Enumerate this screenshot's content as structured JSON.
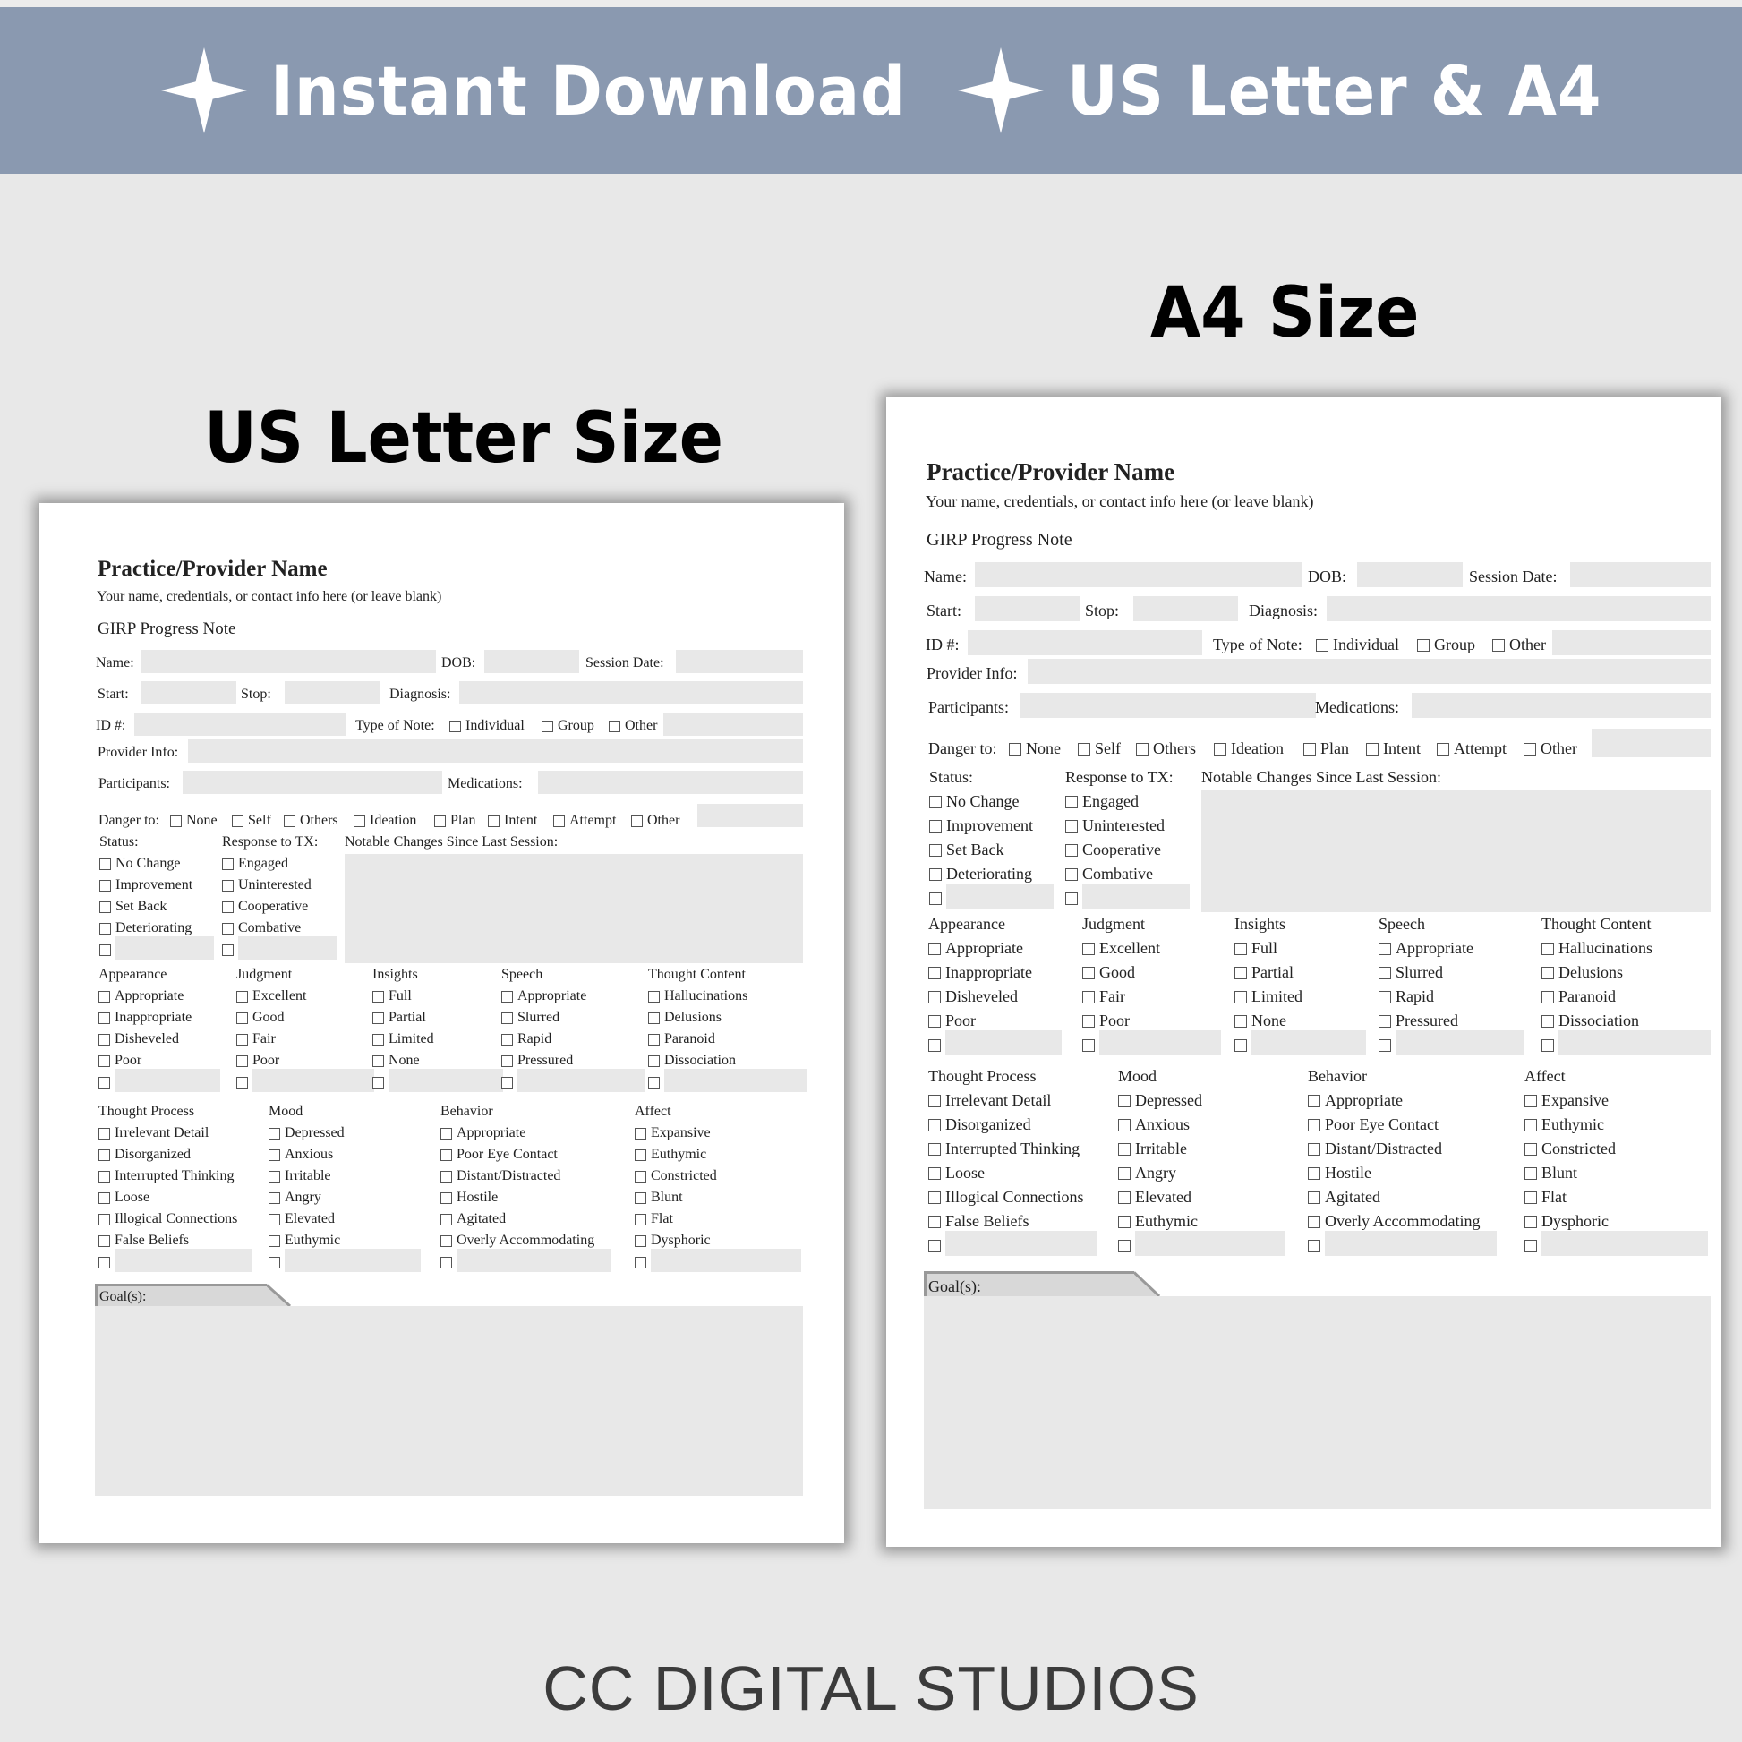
{
  "banner": {
    "color": "#8a99b0",
    "items": [
      {
        "icon": "four-point-star-icon",
        "label": "Instant Download"
      },
      {
        "icon": "four-point-star-icon",
        "label": "US Letter & A4"
      }
    ]
  },
  "titles": {
    "letter": "US Letter Size",
    "a4": "A4 Size"
  },
  "form": {
    "provider_name": "Practice/Provider Name",
    "provider_sub": "Your name, credentials, or contact info here (or leave blank)",
    "note_title": "GIRP Progress Note",
    "labels": {
      "name": "Name:",
      "dob": "DOB:",
      "session_date": "Session Date:",
      "start": "Start:",
      "stop": "Stop:",
      "diagnosis": "Diagnosis:",
      "id": "ID #:",
      "type_of_note": "Type of Note:",
      "provider_info": "Provider Info:",
      "participants": "Participants:",
      "medications": "Medications:",
      "danger_to": "Danger to:",
      "status": "Status:",
      "response": "Response to TX:",
      "notable": "Notable Changes Since Last Session:",
      "goals": "Goal(s):"
    },
    "type_options": [
      "Individual",
      "Group",
      "Other"
    ],
    "danger_options": [
      "None",
      "Self",
      "Others",
      "Ideation",
      "Plan",
      "Intent",
      "Attempt",
      "Other"
    ],
    "status_options": [
      "No Change",
      "Improvement",
      "Set Back",
      "Deteriorating"
    ],
    "response_options": [
      "Engaged",
      "Uninterested",
      "Cooperative",
      "Combative"
    ],
    "groups_row1": [
      {
        "title": "Appearance",
        "options": [
          "Appropriate",
          "Inappropriate",
          "Disheveled",
          "Poor"
        ]
      },
      {
        "title": "Judgment",
        "options": [
          "Excellent",
          "Good",
          "Fair",
          "Poor"
        ]
      },
      {
        "title": "Insights",
        "options": [
          "Full",
          "Partial",
          "Limited",
          "None"
        ]
      },
      {
        "title": "Speech",
        "options": [
          "Appropriate",
          "Slurred",
          "Rapid",
          "Pressured"
        ]
      },
      {
        "title": "Thought Content",
        "options": [
          "Hallucinations",
          "Delusions",
          "Paranoid",
          "Dissociation"
        ]
      }
    ],
    "groups_row2": [
      {
        "title": "Thought Process",
        "options": [
          "Irrelevant Detail",
          "Disorganized",
          "Interrupted Thinking",
          "Loose",
          "Illogical Connections",
          "False Beliefs"
        ]
      },
      {
        "title": "Mood",
        "options": [
          "Depressed",
          "Anxious",
          "Irritable",
          "Angry",
          "Elevated",
          "Euthymic"
        ]
      },
      {
        "title": "Behavior",
        "options": [
          "Appropriate",
          "Poor Eye Contact",
          "Distant/Distracted",
          "Hostile",
          "Agitated",
          "Overly Accommodating"
        ]
      },
      {
        "title": "Affect",
        "options": [
          "Expansive",
          "Euthymic",
          "Constricted",
          "Blunt",
          "Flat",
          "Dysphoric"
        ]
      }
    ]
  },
  "footer": "CC DIGITAL STUDIOS"
}
